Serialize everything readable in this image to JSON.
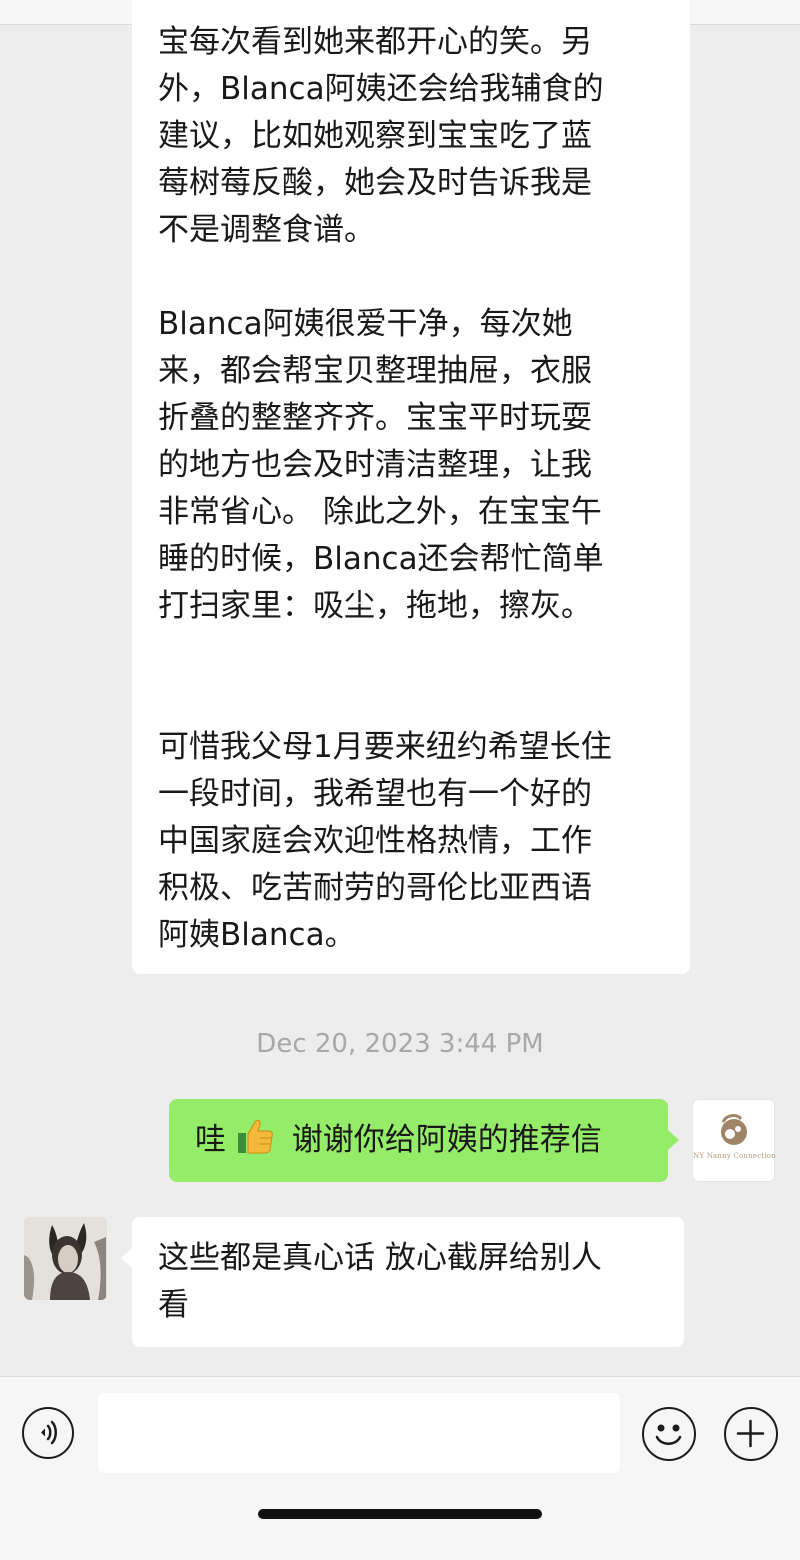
{
  "messages": {
    "received_long": {
      "text": "宝每次看到她来都开心的笑。另\n外，Blanca阿姨还会给我辅食的\n建议，比如她观察到宝宝吃了蓝\n莓树莓反酸，她会及时告诉我是\n不是调整食谱。\n\nBlanca阿姨很爱干净，每次她\n来，都会帮宝贝整理抽屉，衣服\n折叠的整整齐齐。宝宝平时玩耍\n的地方也会及时清洁整理，让我\n非常省心。 除此之外，在宝宝午\n睡的时候，Blanca还会帮忙简单\n打扫家里：吸尘，拖地，擦灰。\n\n\n可惜我父母1月要来纽约希望长住\n一段时间，我希望也有一个好的\n中国家庭会欢迎性格热情，工作\n积极、吃苦耐劳的哥伦比亚西语\n阿姨Blanca。"
    },
    "timestamp": "Dec 20, 2023 3:44 PM",
    "sent": {
      "prefix": "哇",
      "emoji": "thumbs-up",
      "suffix": " 谢谢你给阿姨的推荐信"
    },
    "self_avatar": {
      "brand": "NY Nanny Connection"
    },
    "received_short": {
      "text": "这些都是真心话 放心截屏给别人\n看"
    }
  },
  "input_bar": {
    "placeholder": "",
    "icons": [
      "voice-icon",
      "emoji-icon",
      "plus-icon"
    ]
  },
  "colors": {
    "background": "#ededed",
    "sent_bubble": "#95ec69",
    "received_bubble": "#ffffff",
    "timestamp": "#a8a8a8"
  }
}
